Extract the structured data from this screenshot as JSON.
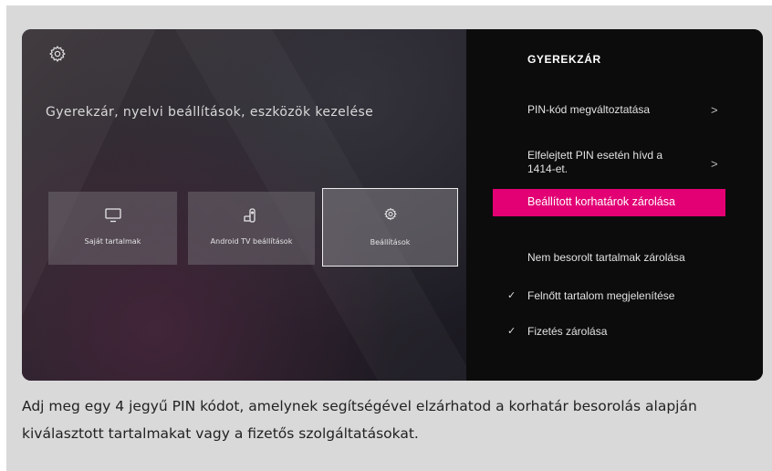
{
  "screen": {
    "gear_icon": "gear-icon",
    "subtitle": "Gyerekzár, nyelvi beállítások, eszközök kezelése",
    "tiles": [
      {
        "label": "Saját tartalmak",
        "icon": "tv-monitor-icon"
      },
      {
        "label": "Android TV beállítások",
        "icon": "android-tv-remote-icon"
      },
      {
        "label": "Beállítások",
        "icon": "gear-icon",
        "focused": true
      }
    ]
  },
  "side_panel": {
    "title": "GYEREKZÁR",
    "items": [
      {
        "label": "PIN-kód megváltoztatása",
        "chevron": ">"
      },
      {
        "label_line1": "Elfelejtett PIN esetén hívd a",
        "label_line2": "1414-et.",
        "chevron": ">"
      },
      {
        "label": "Beállított korhatárok zárolása",
        "highlighted": true
      },
      {
        "label": "Nem besorolt tartalmak zárolása"
      },
      {
        "label": "Felnőtt tartalom megjelenítése",
        "check": "✓"
      },
      {
        "label": "Fizetés zárolása",
        "check": "✓"
      }
    ],
    "accent_color": "#e20074"
  },
  "caption": {
    "line1": "Adj meg egy 4 jegyű PIN kódot, amelynek segítségével elzárhatod a korhatár besorolás alapján",
    "line2": "kiválasztott tartalmakat vagy a fizetős szolgáltatásokat."
  }
}
